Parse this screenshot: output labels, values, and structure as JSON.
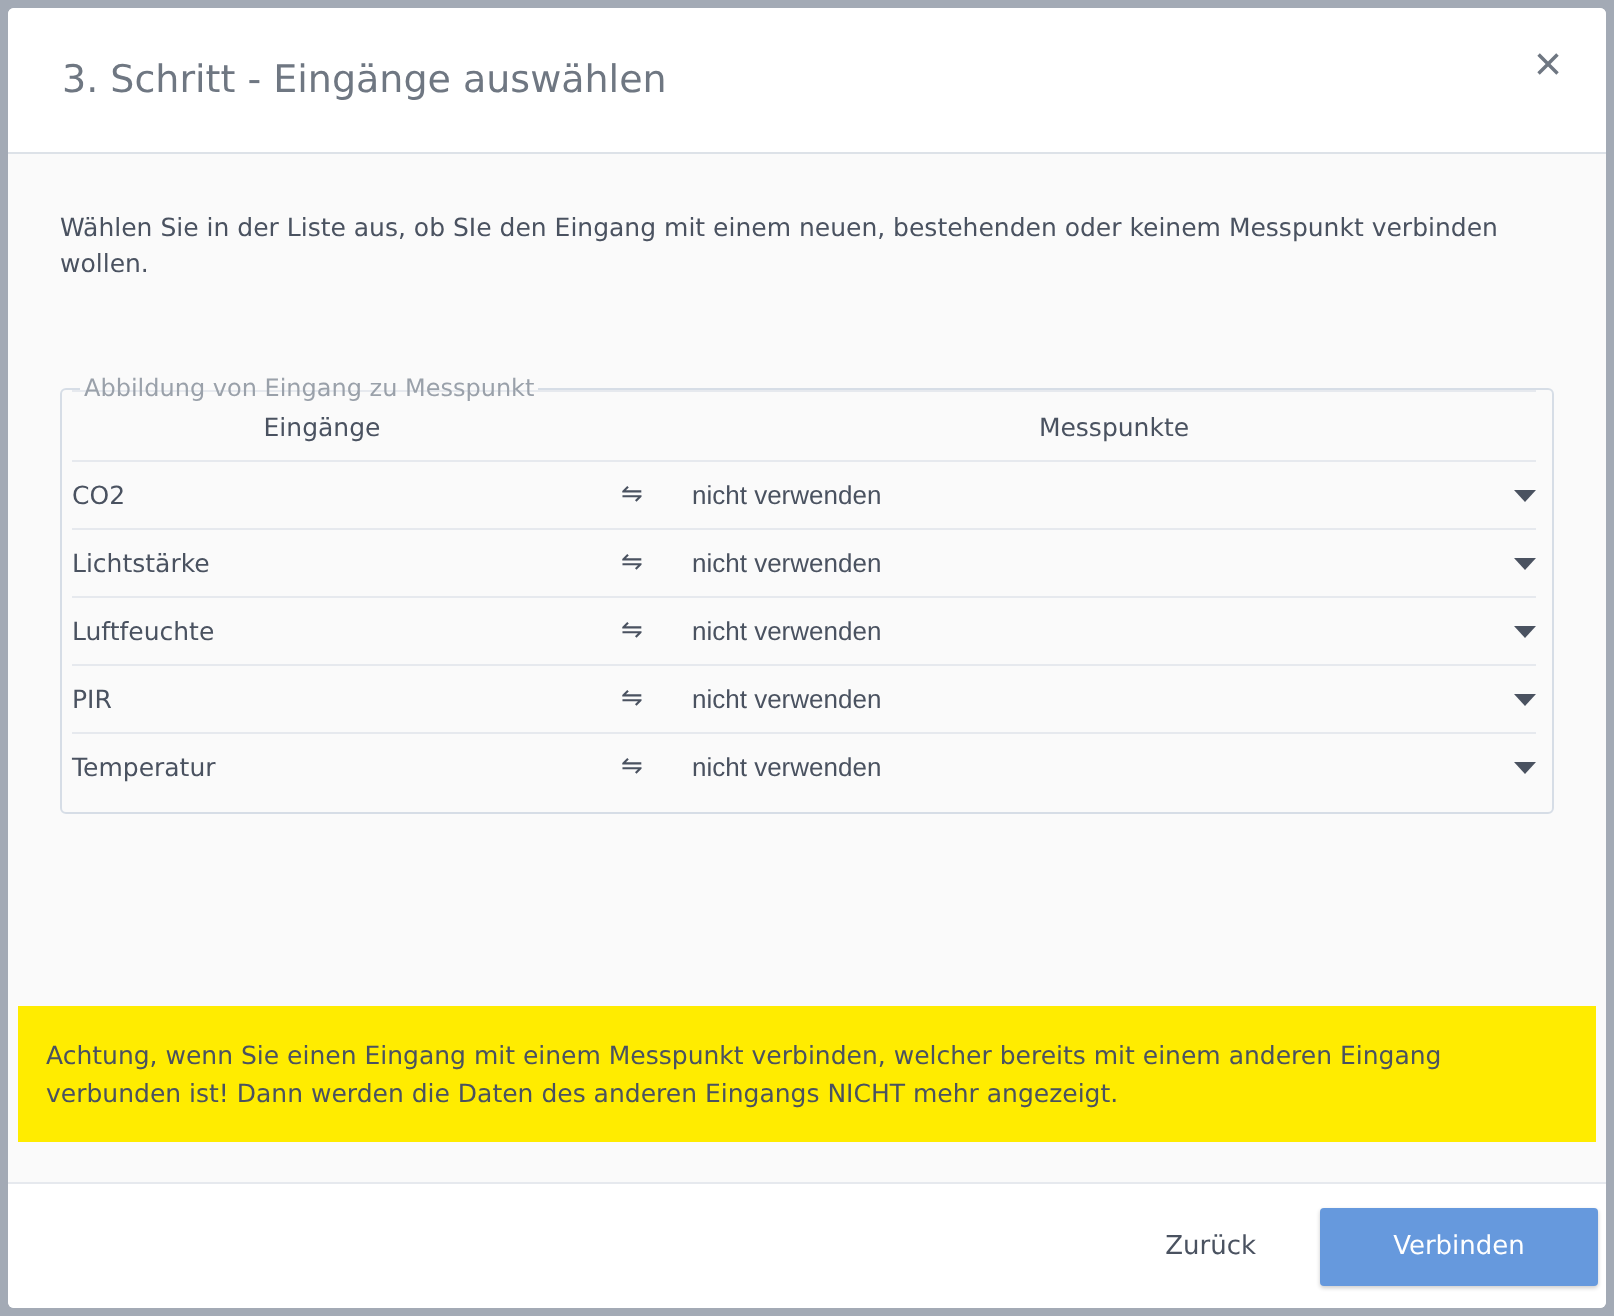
{
  "dialog": {
    "title": "3. Schritt - Eingänge auswählen",
    "close": "×"
  },
  "description": "Wählen Sie in der Liste aus, ob SIe den Eingang mit einem neuen, bestehenden oder keinem Messpunkt verbinden wollen.",
  "mapping": {
    "legend": "Abbildung von Eingang zu Messpunkt",
    "columns": [
      "Eingänge",
      "Messpunkte"
    ],
    "rows": [
      {
        "input": "CO2",
        "link": "⇋",
        "measure_point": "nicht verwenden"
      },
      {
        "input": "Lichtstärke",
        "link": "⇋",
        "measure_point": "nicht verwenden"
      },
      {
        "input": "Luftfeuchte",
        "link": "⇋",
        "measure_point": "nicht verwenden"
      },
      {
        "input": "PIR",
        "link": "⇋",
        "measure_point": "nicht verwenden"
      },
      {
        "input": "Temperatur",
        "link": "⇋",
        "measure_point": "nicht verwenden"
      }
    ]
  },
  "warning": "Achtung, wenn Sie einen Eingang mit einem Messpunkt verbinden, welcher bereits mit einem anderen Eingang verbunden ist! Dann werden die Daten des anderen Eingangs NICHT mehr angezeigt.",
  "buttons": [
    {
      "label": "Zurück",
      "kind": "link"
    },
    {
      "label": "Verbinden",
      "kind": "primary"
    }
  ]
}
